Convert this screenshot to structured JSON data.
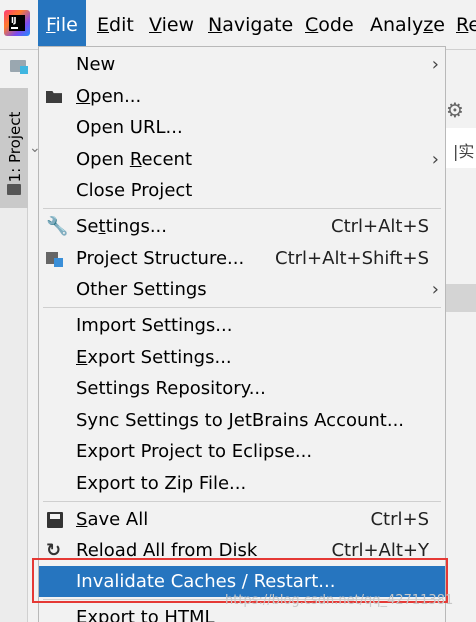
{
  "menubar": {
    "items": [
      {
        "pre": "",
        "mn": "F",
        "post": "ile"
      },
      {
        "pre": "",
        "mn": "E",
        "post": "dit"
      },
      {
        "pre": "",
        "mn": "V",
        "post": "iew"
      },
      {
        "pre": "",
        "mn": "N",
        "post": "avigate"
      },
      {
        "pre": "",
        "mn": "C",
        "post": "ode"
      },
      {
        "pre": "Analy",
        "mn": "z",
        "post": "e"
      },
      {
        "pre": "",
        "mn": "R",
        "post": "e"
      }
    ]
  },
  "sidebar": {
    "project_tab_label": "1: Project"
  },
  "background": {
    "right_peek_text": "|实",
    "watermark": "https://blog.csdn.net/qq_42711381"
  },
  "file_menu": {
    "new": {
      "label": "New"
    },
    "open": {
      "pre": "",
      "mn": "O",
      "post": "pen..."
    },
    "open_url": {
      "label": "Open URL..."
    },
    "open_recent": {
      "pre": "Open ",
      "mn": "R",
      "post": "ecent"
    },
    "close_project": {
      "label": "Close Project"
    },
    "settings": {
      "pre": "Se",
      "mn": "t",
      "post": "tings...",
      "shortcut": "Ctrl+Alt+S"
    },
    "project_structure": {
      "label": "Project Structure...",
      "shortcut": "Ctrl+Alt+Shift+S"
    },
    "other_settings": {
      "label": "Other Settings"
    },
    "import_settings": {
      "label": "Import Settings..."
    },
    "export_settings": {
      "pre": "",
      "mn": "E",
      "post": "xport Settings..."
    },
    "settings_repository": {
      "label": "Settings Repository..."
    },
    "sync_settings": {
      "label": "Sync Settings to JetBrains Account..."
    },
    "export_eclipse": {
      "label": "Export Project to Eclipse..."
    },
    "export_zip": {
      "label": "Export to Zip File..."
    },
    "save_all": {
      "pre": "",
      "mn": "S",
      "post": "ave All",
      "shortcut": "Ctrl+S"
    },
    "reload": {
      "label": "Reload All from Disk",
      "shortcut": "Ctrl+Alt+Y"
    },
    "invalidate": {
      "label": "Invalidate Caches / Restart..."
    },
    "export_html": {
      "label": "Export to HTML"
    }
  },
  "colors": {
    "selection": "#2675bf",
    "annotation_box": "#e53935"
  },
  "icons": [
    "app-logo",
    "project-folder-icon",
    "open-folder-icon",
    "wrench-icon",
    "project-structure-icon",
    "save-icon",
    "reload-icon",
    "gear-icon",
    "chevron-right-icon"
  ]
}
